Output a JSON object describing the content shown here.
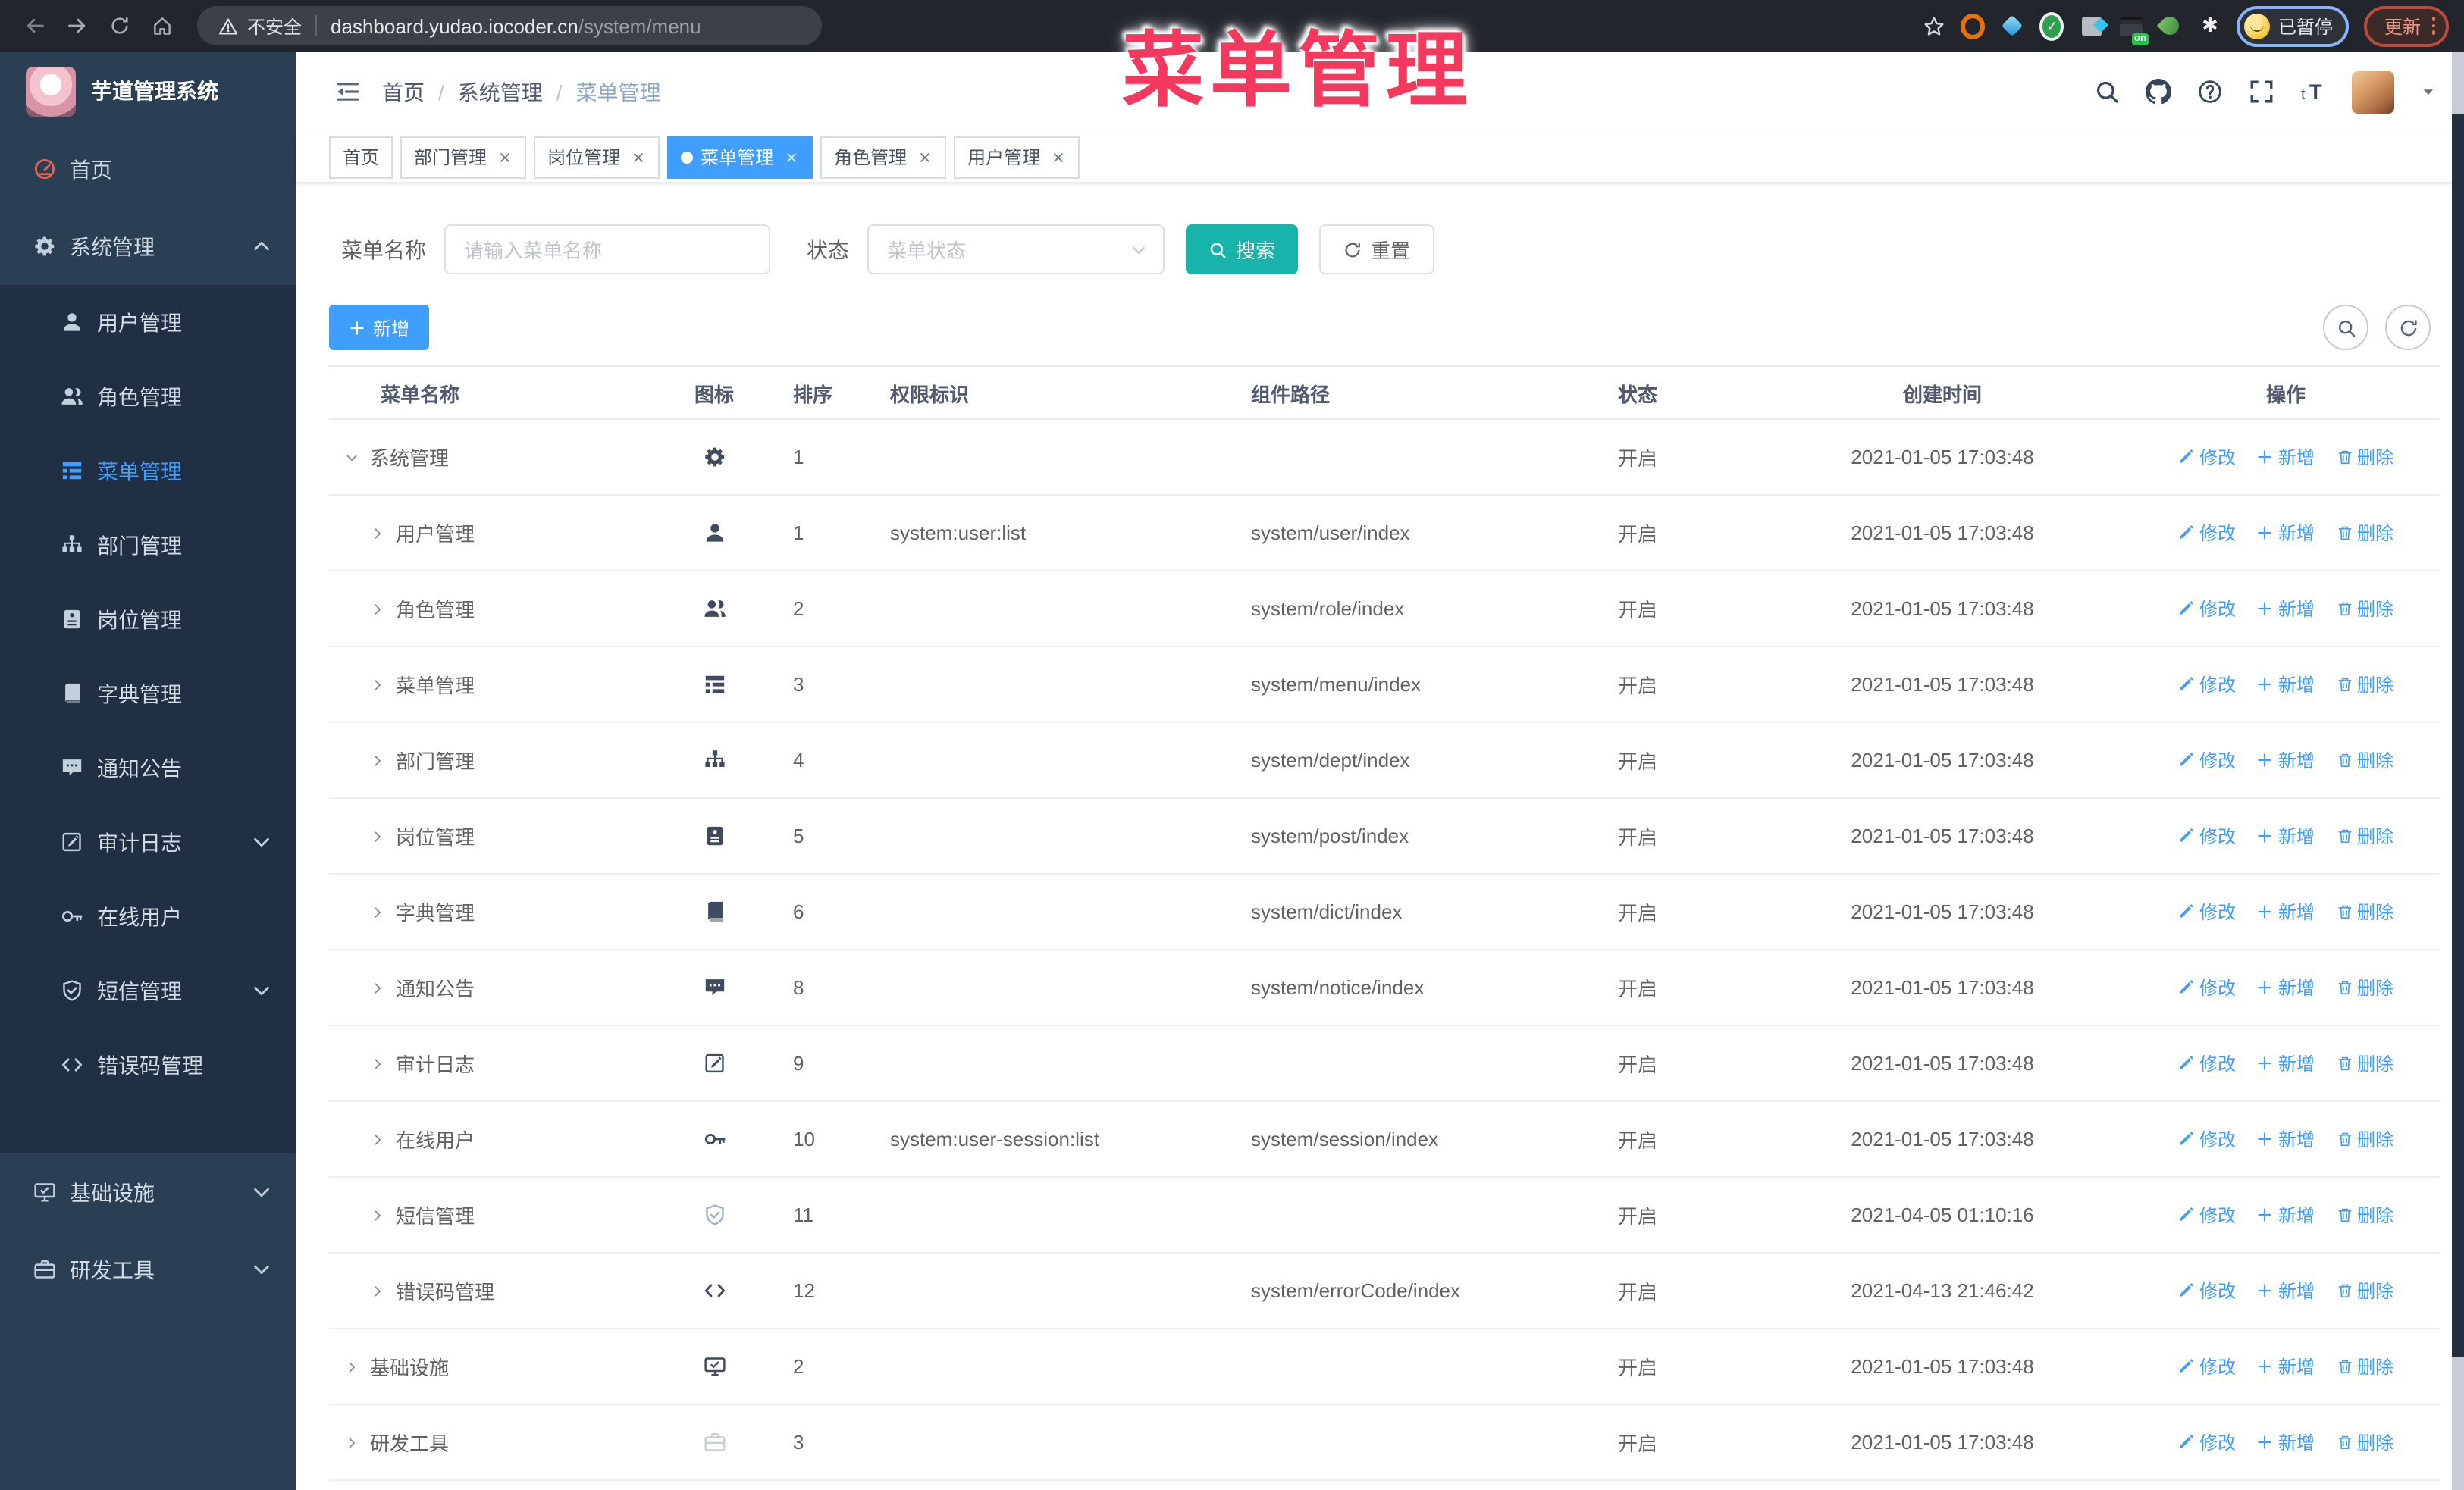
{
  "overlay_title": "菜单管理",
  "browser": {
    "security_label": "不安全",
    "url_host": "dashboard.yudao.iocoder.cn",
    "url_path": "/system/menu",
    "extension_on_badge": "on",
    "profile_badge": "已暂停",
    "update_label": "更新"
  },
  "colors": {
    "primary": "#409eff",
    "search_button": "#18b3aa",
    "overlay_annotation": "#f4395f",
    "sidebar_bg": "#2a3e54",
    "submenu_bg": "#202f44"
  },
  "sidebar": {
    "logo_title": "芋道管理系统",
    "items": [
      {
        "label": "首页",
        "icon": "dashboard-icon",
        "level": 0
      },
      {
        "label": "系统管理",
        "icon": "gear-icon",
        "level": 0,
        "chevron": "up",
        "open": true
      },
      {
        "label": "用户管理",
        "icon": "user-icon",
        "level": 1
      },
      {
        "label": "角色管理",
        "icon": "users-icon",
        "level": 1
      },
      {
        "label": "菜单管理",
        "icon": "menu-icon",
        "level": 1,
        "active": true
      },
      {
        "label": "部门管理",
        "icon": "dept-icon",
        "level": 1
      },
      {
        "label": "岗位管理",
        "icon": "post-icon",
        "level": 1
      },
      {
        "label": "字典管理",
        "icon": "dict-icon",
        "level": 1
      },
      {
        "label": "通知公告",
        "icon": "message-icon",
        "level": 1
      },
      {
        "label": "审计日志",
        "icon": "log-icon",
        "level": 1,
        "chevron": "down"
      },
      {
        "label": "在线用户",
        "icon": "online-icon",
        "level": 1
      },
      {
        "label": "短信管理",
        "icon": "sms-icon",
        "level": 1,
        "chevron": "down"
      },
      {
        "label": "错误码管理",
        "icon": "code-icon",
        "level": 1
      },
      {
        "label": "基础设施",
        "icon": "infra-icon",
        "level": 0,
        "chevron": "down"
      },
      {
        "label": "研发工具",
        "icon": "tool-icon",
        "level": 0,
        "chevron": "down"
      }
    ]
  },
  "header": {
    "breadcrumb": [
      "首页",
      "系统管理",
      "菜单管理"
    ]
  },
  "tabs": [
    {
      "label": "首页",
      "closable": false,
      "active": false
    },
    {
      "label": "部门管理",
      "closable": true,
      "active": false
    },
    {
      "label": "岗位管理",
      "closable": true,
      "active": false
    },
    {
      "label": "菜单管理",
      "closable": true,
      "active": true
    },
    {
      "label": "角色管理",
      "closable": true,
      "active": false
    },
    {
      "label": "用户管理",
      "closable": true,
      "active": false
    }
  ],
  "filters": {
    "name_label": "菜单名称",
    "name_placeholder": "请输入菜单名称",
    "status_label": "状态",
    "status_placeholder": "菜单状态",
    "search_label": "搜索",
    "reset_label": "重置"
  },
  "toolbar": {
    "add_label": "新增"
  },
  "table": {
    "columns": [
      {
        "label": "菜单名称",
        "key": "name"
      },
      {
        "label": "图标",
        "key": "icon"
      },
      {
        "label": "排序",
        "key": "sort"
      },
      {
        "label": "权限标识",
        "key": "perm"
      },
      {
        "label": "组件路径",
        "key": "path"
      },
      {
        "label": "状态",
        "key": "status"
      },
      {
        "label": "创建时间",
        "key": "time"
      },
      {
        "label": "操作",
        "key": "ops"
      }
    ],
    "ops": [
      "修改",
      "新增",
      "删除"
    ],
    "rows": [
      {
        "name": "系统管理",
        "icon": "gear-icon",
        "level": 0,
        "expanded": true,
        "sort": "1",
        "perm": "",
        "path": "",
        "status": "开启",
        "time": "2021-01-05 17:03:48"
      },
      {
        "name": "用户管理",
        "icon": "user-icon",
        "level": 1,
        "sort": "1",
        "perm": "system:user:list",
        "path": "system/user/index",
        "status": "开启",
        "time": "2021-01-05 17:03:48"
      },
      {
        "name": "角色管理",
        "icon": "users-icon",
        "level": 1,
        "sort": "2",
        "perm": "",
        "path": "system/role/index",
        "status": "开启",
        "time": "2021-01-05 17:03:48"
      },
      {
        "name": "菜单管理",
        "icon": "menu-icon",
        "level": 1,
        "sort": "3",
        "perm": "",
        "path": "system/menu/index",
        "status": "开启",
        "time": "2021-01-05 17:03:48"
      },
      {
        "name": "部门管理",
        "icon": "dept-icon",
        "level": 1,
        "sort": "4",
        "perm": "",
        "path": "system/dept/index",
        "status": "开启",
        "time": "2021-01-05 17:03:48"
      },
      {
        "name": "岗位管理",
        "icon": "post-icon",
        "level": 1,
        "sort": "5",
        "perm": "",
        "path": "system/post/index",
        "status": "开启",
        "time": "2021-01-05 17:03:48"
      },
      {
        "name": "字典管理",
        "icon": "dict-icon",
        "level": 1,
        "sort": "6",
        "perm": "",
        "path": "system/dict/index",
        "status": "开启",
        "time": "2021-01-05 17:03:48"
      },
      {
        "name": "通知公告",
        "icon": "message-icon",
        "level": 1,
        "sort": "8",
        "perm": "",
        "path": "system/notice/index",
        "status": "开启",
        "time": "2021-01-05 17:03:48"
      },
      {
        "name": "审计日志",
        "icon": "log-icon",
        "level": 1,
        "sort": "9",
        "perm": "",
        "path": "",
        "status": "开启",
        "time": "2021-01-05 17:03:48"
      },
      {
        "name": "在线用户",
        "icon": "online-icon",
        "level": 1,
        "sort": "10",
        "perm": "system:user-session:list",
        "path": "system/session/index",
        "status": "开启",
        "time": "2021-01-05 17:03:48"
      },
      {
        "name": "短信管理",
        "icon": "sms-icon",
        "icon_tone": "muted",
        "level": 1,
        "sort": "11",
        "perm": "",
        "path": "",
        "status": "开启",
        "time": "2021-04-05 01:10:16"
      },
      {
        "name": "错误码管理",
        "icon": "code-icon",
        "level": 1,
        "sort": "12",
        "perm": "",
        "path": "system/errorCode/index",
        "status": "开启",
        "time": "2021-04-13 21:46:42"
      },
      {
        "name": "基础设施",
        "icon": "infra-icon",
        "level": 0,
        "sort": "2",
        "perm": "",
        "path": "",
        "status": "开启",
        "time": "2021-01-05 17:03:48"
      },
      {
        "name": "研发工具",
        "icon": "tool-icon",
        "icon_tone": "light",
        "level": 0,
        "sort": "3",
        "perm": "",
        "path": "",
        "status": "开启",
        "time": "2021-01-05 17:03:48"
      }
    ]
  }
}
